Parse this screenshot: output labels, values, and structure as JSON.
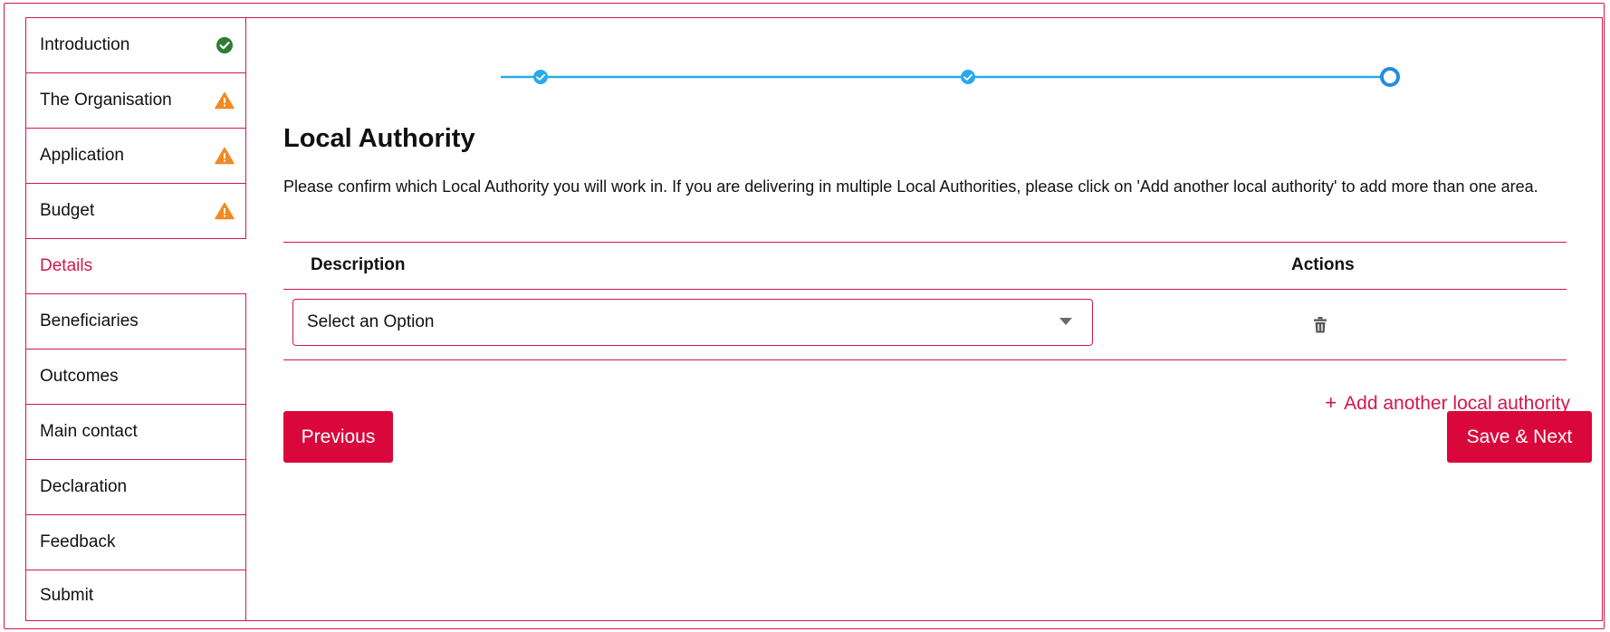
{
  "sidebar": {
    "items": [
      {
        "label": "Introduction",
        "status": "complete"
      },
      {
        "label": "The Organisation",
        "status": "warning"
      },
      {
        "label": "Application",
        "status": "warning"
      },
      {
        "label": "Budget",
        "status": "warning"
      },
      {
        "label": "Details",
        "status": "active"
      },
      {
        "label": "Beneficiaries",
        "status": ""
      },
      {
        "label": "Outcomes",
        "status": ""
      },
      {
        "label": "Main contact",
        "status": ""
      },
      {
        "label": "Declaration",
        "status": ""
      },
      {
        "label": "Feedback",
        "status": ""
      },
      {
        "label": "Submit",
        "status": ""
      }
    ]
  },
  "stepper": {
    "steps": [
      "complete",
      "complete",
      "current"
    ],
    "color": "#29a9ea"
  },
  "main": {
    "title": "Local Authority",
    "description": "Please confirm which Local Authority you will work in. If you are delivering in multiple Local Authorities, please click on 'Add another local authority' to add more than one area.",
    "table": {
      "headers": {
        "description": "Description",
        "actions": "Actions"
      },
      "rows": [
        {
          "select_placeholder": "Select an Option"
        }
      ]
    },
    "add_link": "Add another local authority",
    "add_link_plus": "+",
    "buttons": {
      "previous": "Previous",
      "next": "Save & Next"
    }
  },
  "colors": {
    "accent": "#d4174a",
    "button": "#d9073c",
    "success": "#2e7d32",
    "warning": "#f08a24",
    "stepper": "#29a9ea"
  }
}
